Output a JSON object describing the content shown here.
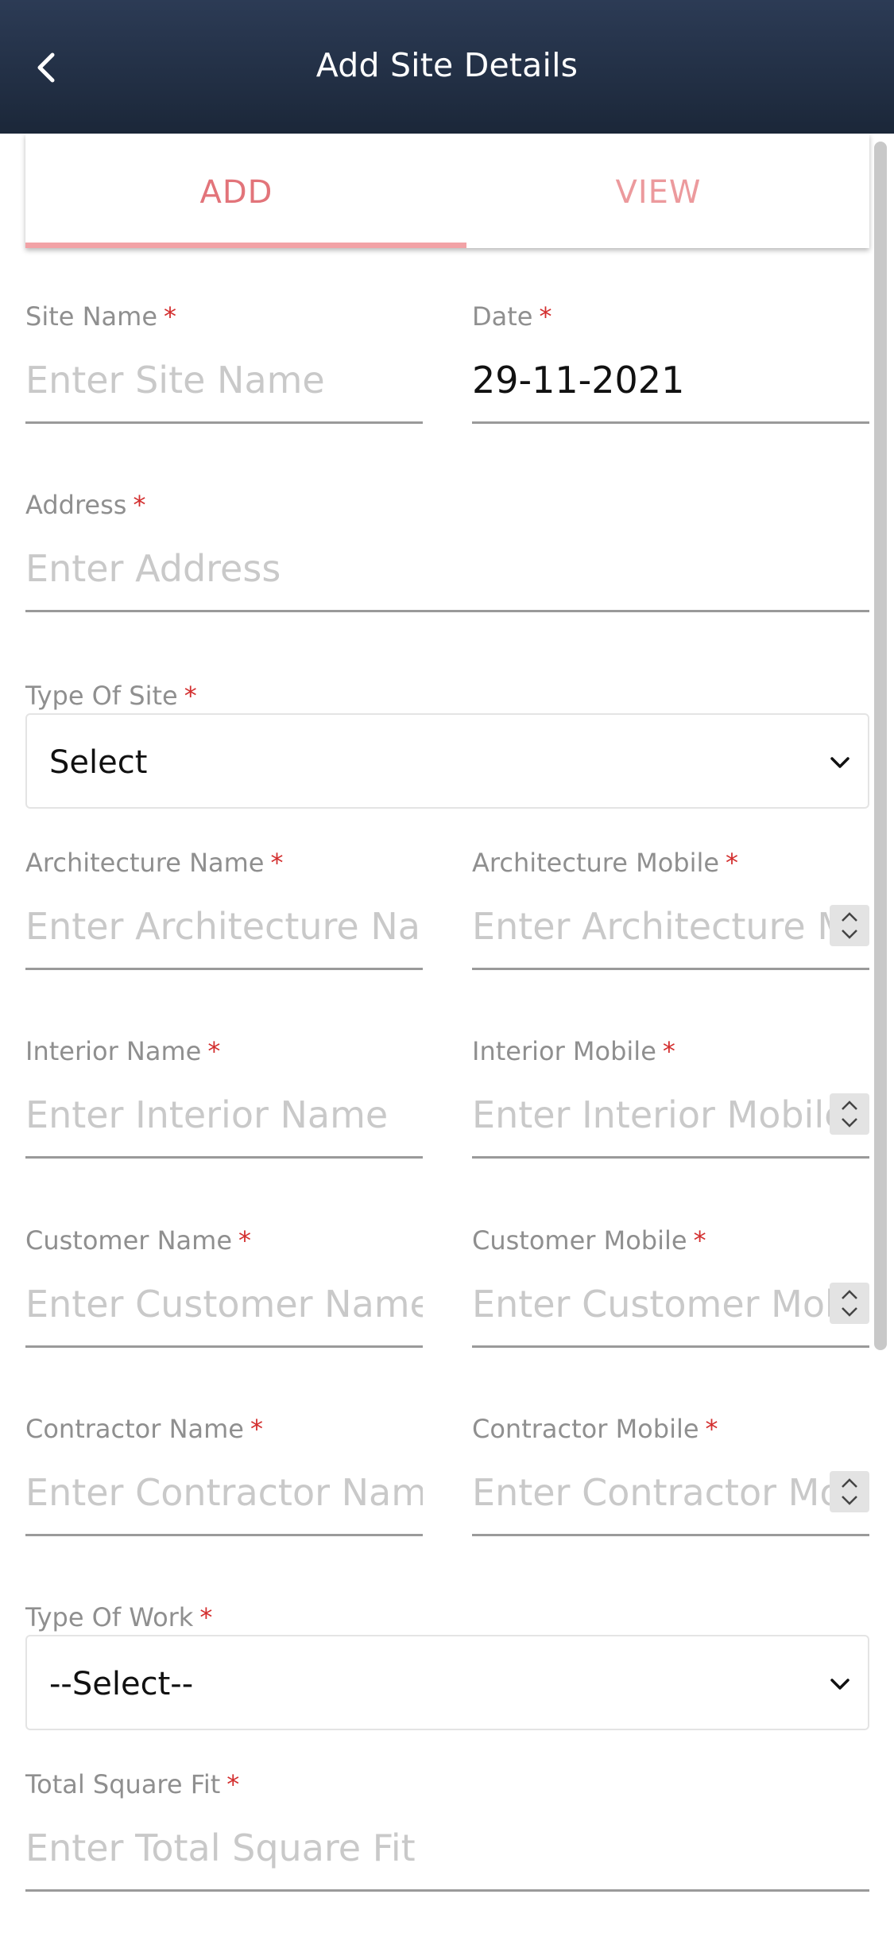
{
  "header": {
    "title": "Add Site Details",
    "back_icon": "chevron-left-icon"
  },
  "tabs": [
    {
      "label": "ADD"
    },
    {
      "label": "VIEW"
    }
  ],
  "colors": {
    "header_bg": "#1b2739",
    "tab_accent": "#e2747a",
    "required": "#d32f2f"
  },
  "form": {
    "site_name": {
      "label": "Site Name",
      "placeholder": "Enter Site Name"
    },
    "date": {
      "label": "Date",
      "value": "29-11-2021"
    },
    "address": {
      "label": "Address",
      "placeholder": "Enter Address"
    },
    "type_of_site": {
      "label": "Type Of Site",
      "selected": "Select"
    },
    "architecture_name": {
      "label": "Architecture Name",
      "placeholder": "Enter Architecture Name"
    },
    "architecture_mobile": {
      "label": "Architecture Mobile",
      "placeholder": "Enter Architecture Mobile"
    },
    "interior_name": {
      "label": "Interior Name",
      "placeholder": "Enter Interior Name"
    },
    "interior_mobile": {
      "label": "Interior Mobile",
      "placeholder": "Enter Interior Mobile"
    },
    "customer_name": {
      "label": "Customer Name",
      "placeholder": "Enter Customer Name"
    },
    "customer_mobile": {
      "label": "Customer Mobile",
      "placeholder": "Enter Customer Mobile"
    },
    "contractor_name": {
      "label": "Contractor Name",
      "placeholder": "Enter Contractor Name"
    },
    "contractor_mobile": {
      "label": "Contractor Mobile",
      "placeholder": "Enter Contractor Mobile"
    },
    "type_of_work": {
      "label": "Type Of Work",
      "selected": "--Select--"
    },
    "total_square_fit": {
      "label": "Total Square Fit",
      "placeholder": "Enter Total Square Fit"
    },
    "required_marker": "*"
  }
}
